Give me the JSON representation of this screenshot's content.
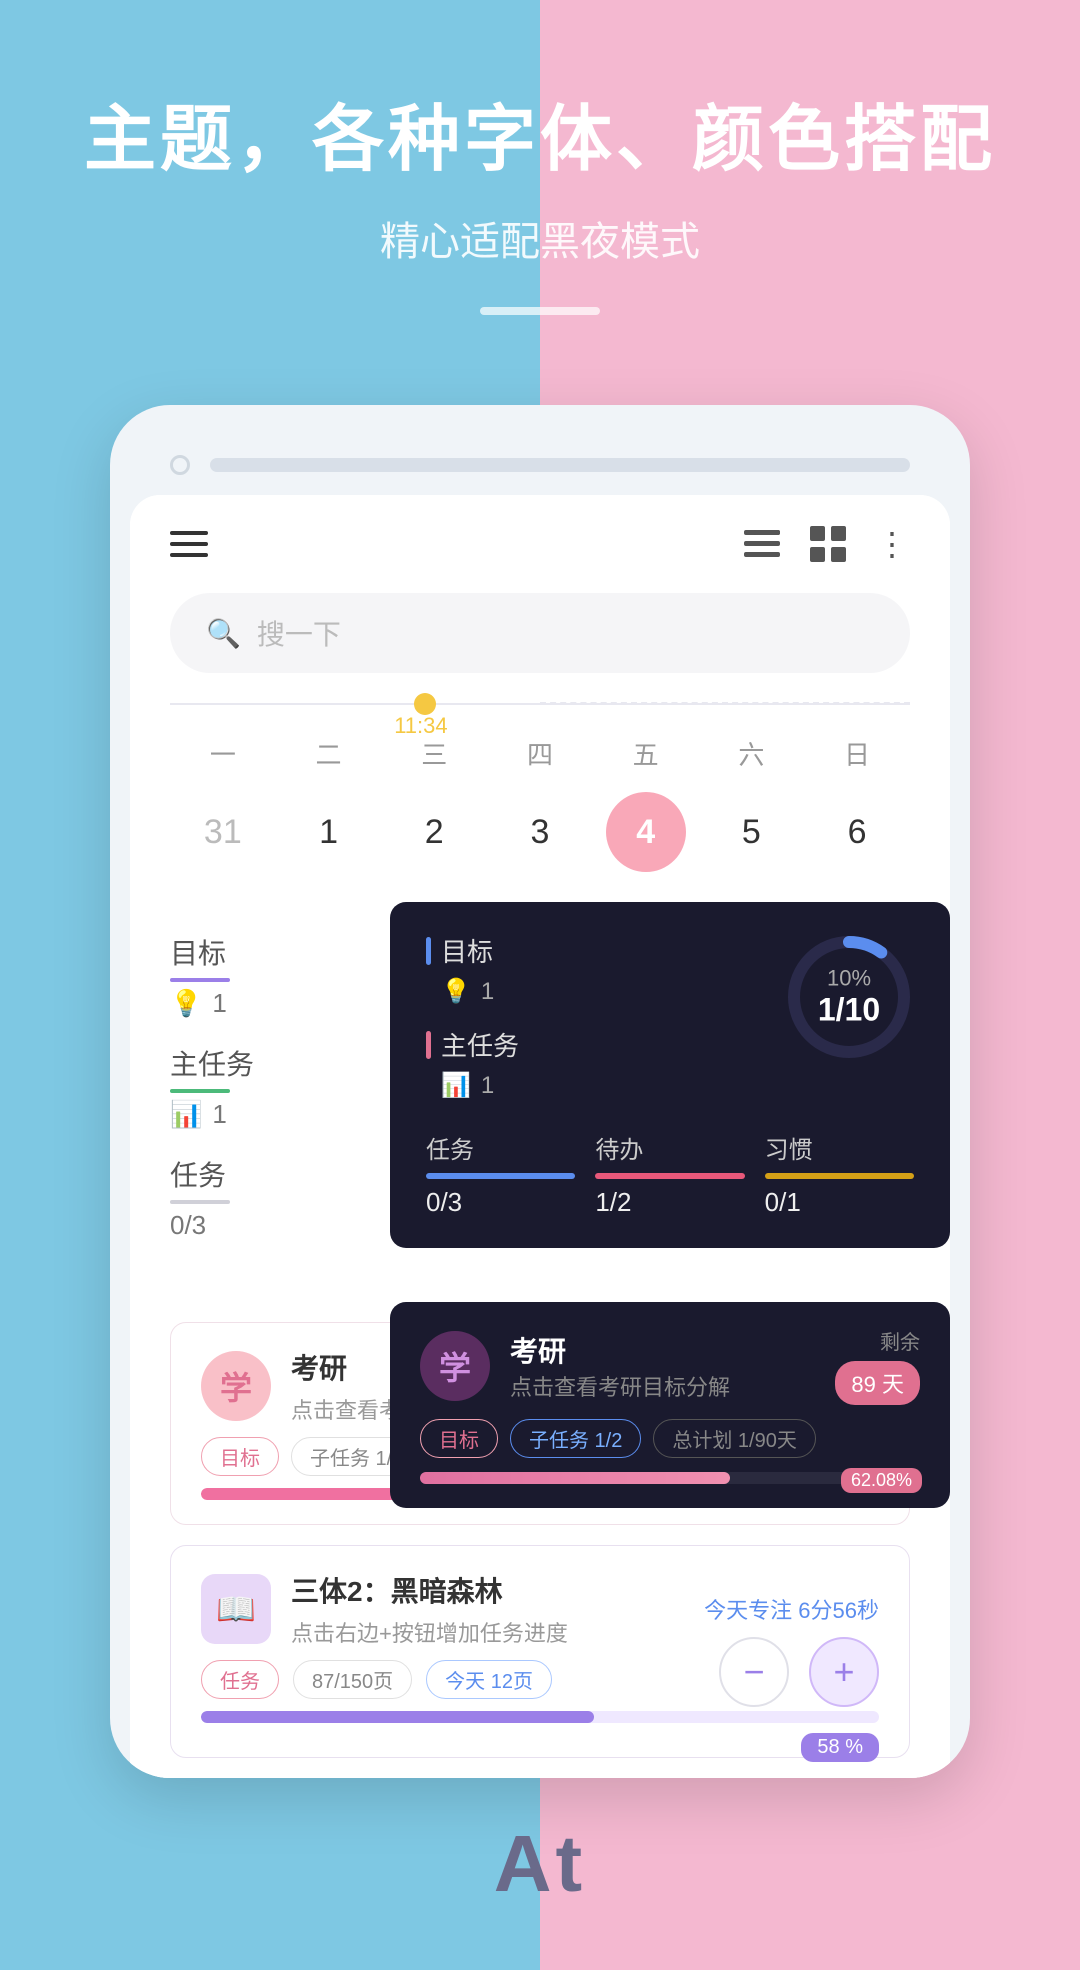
{
  "hero": {
    "title": "主题，各种字体、颜色搭配",
    "subtitle": "精心适配黑夜模式",
    "divider_visible": true
  },
  "phone": {
    "search_placeholder": "搜一下",
    "timeline_time": "11:34",
    "week": {
      "days": [
        "一",
        "二",
        "三",
        "四",
        "五",
        "六",
        "日"
      ],
      "dates": [
        "31",
        "1",
        "2",
        "3",
        "4",
        "5",
        "6"
      ],
      "today_index": 4
    }
  },
  "stats_light": {
    "goal_label": "目标",
    "goal_icon": "💡",
    "goal_count": "1",
    "main_task_label": "主任务",
    "main_task_icon": "📊",
    "main_task_count": "1",
    "task_label": "任务",
    "task_val": "0/3"
  },
  "stats_dark": {
    "goal_label": "目标",
    "goal_icon": "💡",
    "goal_count": "1",
    "main_task_label": "主任务",
    "main_task_icon": "📊",
    "main_task_count": "1",
    "progress_pct": "10%",
    "progress_val": "1/10",
    "task_label": "任务",
    "task_val": "0/3",
    "todo_label": "待办",
    "todo_val": "1/2",
    "habit_label": "习惯",
    "habit_val": "0/1"
  },
  "goal_card_dark": {
    "avatar_text": "学",
    "title": "考研",
    "desc": "点击查看考研目标分解",
    "remaining_label": "剩余",
    "days_badge": "89 天",
    "tag1": "目标",
    "tag2": "子任务 1/2",
    "tag3": "总计划 1/90天",
    "progress_pct": "62.08%",
    "progress_label": "62.08%"
  },
  "goal_card_light": {
    "avatar_text": "学",
    "title": "考研",
    "desc": "点击查看考研目",
    "tag1": "目标",
    "tag2": "子任务 1/",
    "progress_pct": "62.08%",
    "progress_label": "62.08 %"
  },
  "book_card": {
    "avatar_emoji": "📖",
    "title": "三体2：黑暗森林",
    "desc": "点击右边+按钮增加任务进度",
    "focus_label": "今天专注 6分56秒",
    "tag1": "任务",
    "tag2": "87/150页",
    "tag3": "今天 12页",
    "progress_pct": "58%",
    "minus_btn": "−",
    "plus_btn": "+"
  },
  "bottom_label": "At",
  "header_icons": {
    "list_icon": "≡",
    "grid_icon": "⊞",
    "dots_icon": "⋮"
  }
}
